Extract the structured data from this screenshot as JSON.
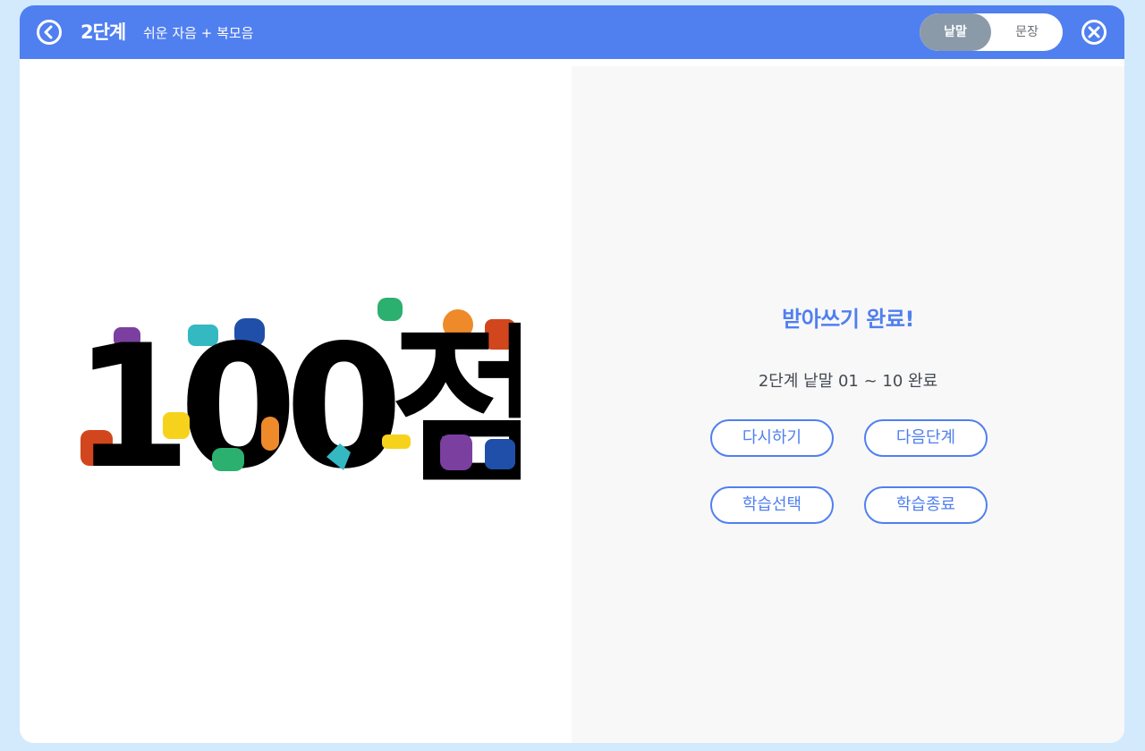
{
  "header": {
    "level_title": "2단계",
    "level_subtitle": "쉬운 자음 + 복모음",
    "back_icon": "chevron-left-circle-icon",
    "close_icon": "close-circle-icon",
    "mode_toggle": {
      "options": [
        "낱말",
        "문장"
      ],
      "selected": "낱말"
    }
  },
  "score_art": {
    "text": "100점!!"
  },
  "result": {
    "title": "받아쓰기 완료!",
    "summary": "2단계 낱말 01 ~ 10 완료",
    "buttons": {
      "retry": "다시하기",
      "next": "다음단계",
      "select": "학습선택",
      "end": "학습종료"
    }
  },
  "colors": {
    "accent": "#507ff0",
    "background": "#d3e9fc",
    "toggle_active": "#8a9aa8",
    "panel_right": "#f8f8f8"
  }
}
